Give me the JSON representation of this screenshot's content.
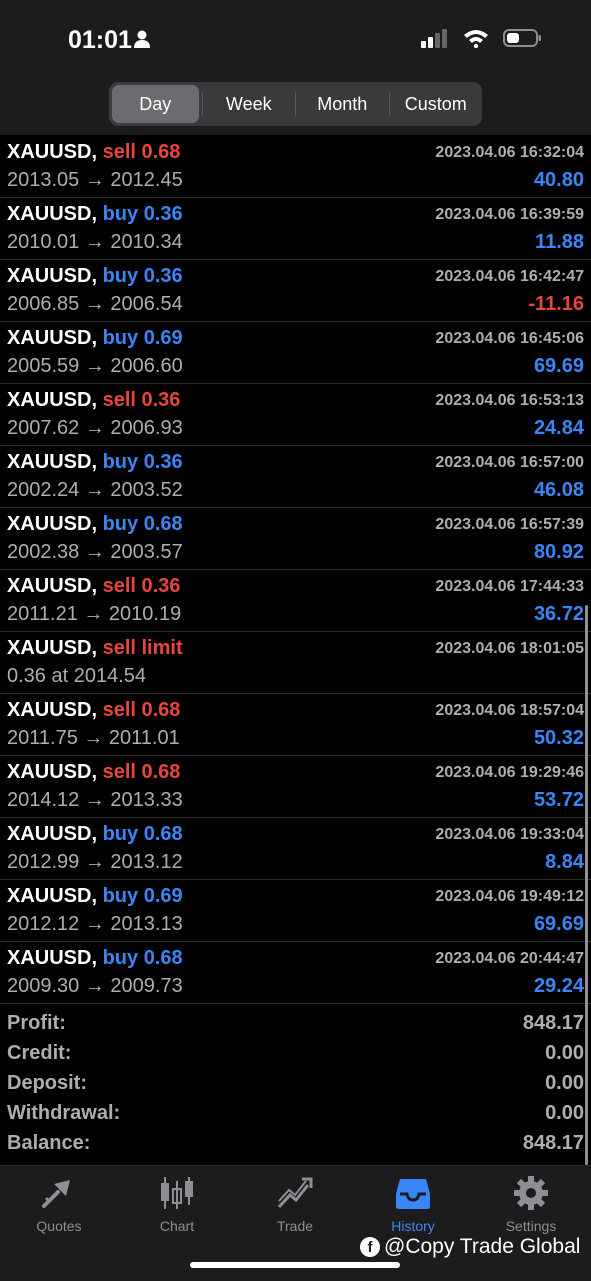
{
  "status": {
    "time": "01:01"
  },
  "segments": [
    {
      "label": "Day",
      "active": true
    },
    {
      "label": "Week",
      "active": false
    },
    {
      "label": "Month",
      "active": false
    },
    {
      "label": "Custom",
      "active": false
    }
  ],
  "rows": [
    {
      "symbol": "XAUUSD,",
      "side": "sell",
      "detail": "0.68",
      "time": "2023.04.06 16:32:04",
      "prices": "2013.05 → 2012.45",
      "profit": "40.80"
    },
    {
      "symbol": "XAUUSD,",
      "side": "buy",
      "detail": "0.36",
      "time": "2023.04.06 16:39:59",
      "prices": "2010.01 → 2010.34",
      "profit": "11.88"
    },
    {
      "symbol": "XAUUSD,",
      "side": "buy",
      "detail": "0.36",
      "time": "2023.04.06 16:42:47",
      "prices": "2006.85 → 2006.54",
      "profit": "-11.16"
    },
    {
      "symbol": "XAUUSD,",
      "side": "buy",
      "detail": "0.69",
      "time": "2023.04.06 16:45:06",
      "prices": "2005.59 → 2006.60",
      "profit": "69.69"
    },
    {
      "symbol": "XAUUSD,",
      "side": "sell",
      "detail": "0.36",
      "time": "2023.04.06 16:53:13",
      "prices": "2007.62 → 2006.93",
      "profit": "24.84"
    },
    {
      "symbol": "XAUUSD,",
      "side": "buy",
      "detail": "0.36",
      "time": "2023.04.06 16:57:00",
      "prices": "2002.24 → 2003.52",
      "profit": "46.08"
    },
    {
      "symbol": "XAUUSD,",
      "side": "buy",
      "detail": "0.68",
      "time": "2023.04.06 16:57:39",
      "prices": "2002.38 → 2003.57",
      "profit": "80.92"
    },
    {
      "symbol": "XAUUSD,",
      "side": "sell",
      "detail": "0.36",
      "time": "2023.04.06 17:44:33",
      "prices": "2011.21 → 2010.19",
      "profit": "36.72"
    },
    {
      "symbol": "XAUUSD,",
      "side": "sell",
      "detail": "limit",
      "time": "2023.04.06 18:01:05",
      "prices": "0.36 at 2014.54",
      "profit": ""
    },
    {
      "symbol": "XAUUSD,",
      "side": "sell",
      "detail": "0.68",
      "time": "2023.04.06 18:57:04",
      "prices": "2011.75 → 2011.01",
      "profit": "50.32"
    },
    {
      "symbol": "XAUUSD,",
      "side": "sell",
      "detail": "0.68",
      "time": "2023.04.06 19:29:46",
      "prices": "2014.12 → 2013.33",
      "profit": "53.72"
    },
    {
      "symbol": "XAUUSD,",
      "side": "buy",
      "detail": "0.68",
      "time": "2023.04.06 19:33:04",
      "prices": "2012.99 → 2013.12",
      "profit": "8.84"
    },
    {
      "symbol": "XAUUSD,",
      "side": "buy",
      "detail": "0.69",
      "time": "2023.04.06 19:49:12",
      "prices": "2012.12 → 2013.13",
      "profit": "69.69"
    },
    {
      "symbol": "XAUUSD,",
      "side": "buy",
      "detail": "0.68",
      "time": "2023.04.06 20:44:47",
      "prices": "2009.30 → 2009.73",
      "profit": "29.24"
    }
  ],
  "summary": [
    {
      "label": "Profit:",
      "value": "848.17"
    },
    {
      "label": "Credit:",
      "value": "0.00"
    },
    {
      "label": "Deposit:",
      "value": "0.00"
    },
    {
      "label": "Withdrawal:",
      "value": "0.00"
    },
    {
      "label": "Balance:",
      "value": "848.17"
    }
  ],
  "tabs": [
    {
      "label": "Quotes",
      "icon": "quotes-icon",
      "active": false
    },
    {
      "label": "Chart",
      "icon": "chart-icon",
      "active": false
    },
    {
      "label": "Trade",
      "icon": "trade-icon",
      "active": false
    },
    {
      "label": "History",
      "icon": "history-icon",
      "active": true
    },
    {
      "label": "Settings",
      "icon": "settings-icon",
      "active": false
    }
  ],
  "watermark": "@Copy Trade Global",
  "colors": {
    "sell": "#e8453c",
    "buy": "#3b86f7",
    "accent": "#3b86f7"
  }
}
